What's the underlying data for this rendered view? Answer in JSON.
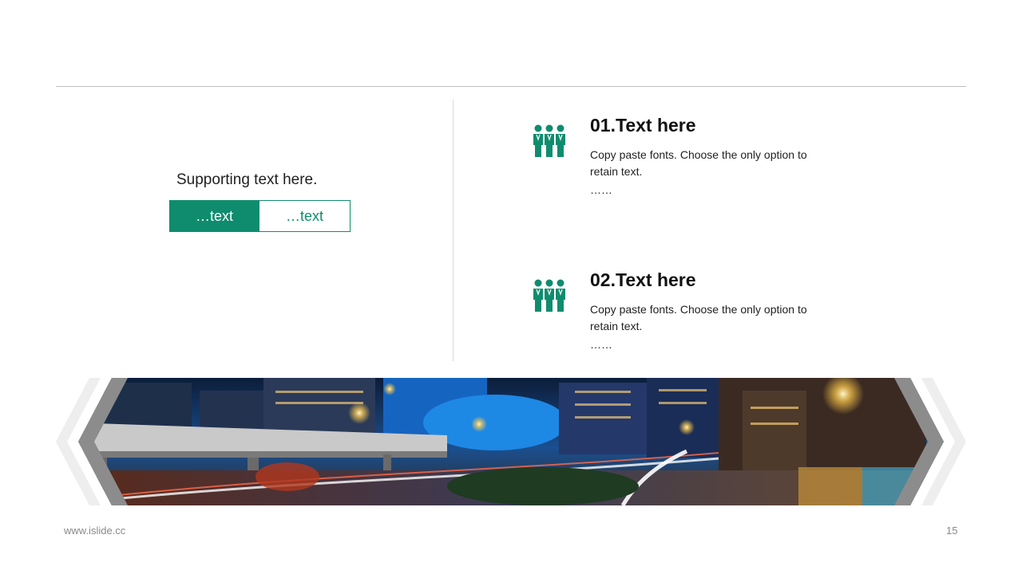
{
  "left": {
    "supporting_text": "Supporting text here.",
    "buttons": [
      "…text",
      "…text"
    ]
  },
  "items": [
    {
      "title": "01.Text here",
      "body": "Copy paste fonts. Choose the only option to retain text.",
      "ellipsis": "……"
    },
    {
      "title": "02.Text here",
      "body": "Copy paste fonts. Choose the only option to retain text.",
      "ellipsis": "……"
    }
  ],
  "icons": {
    "item_icon": "team-people-icon"
  },
  "footer": {
    "url": "www.islide.cc",
    "page": "15"
  },
  "colors": {
    "accent": "#0f8c6e",
    "frame_dark": "#8c8c8c",
    "frame_light": "#eeeeee"
  }
}
